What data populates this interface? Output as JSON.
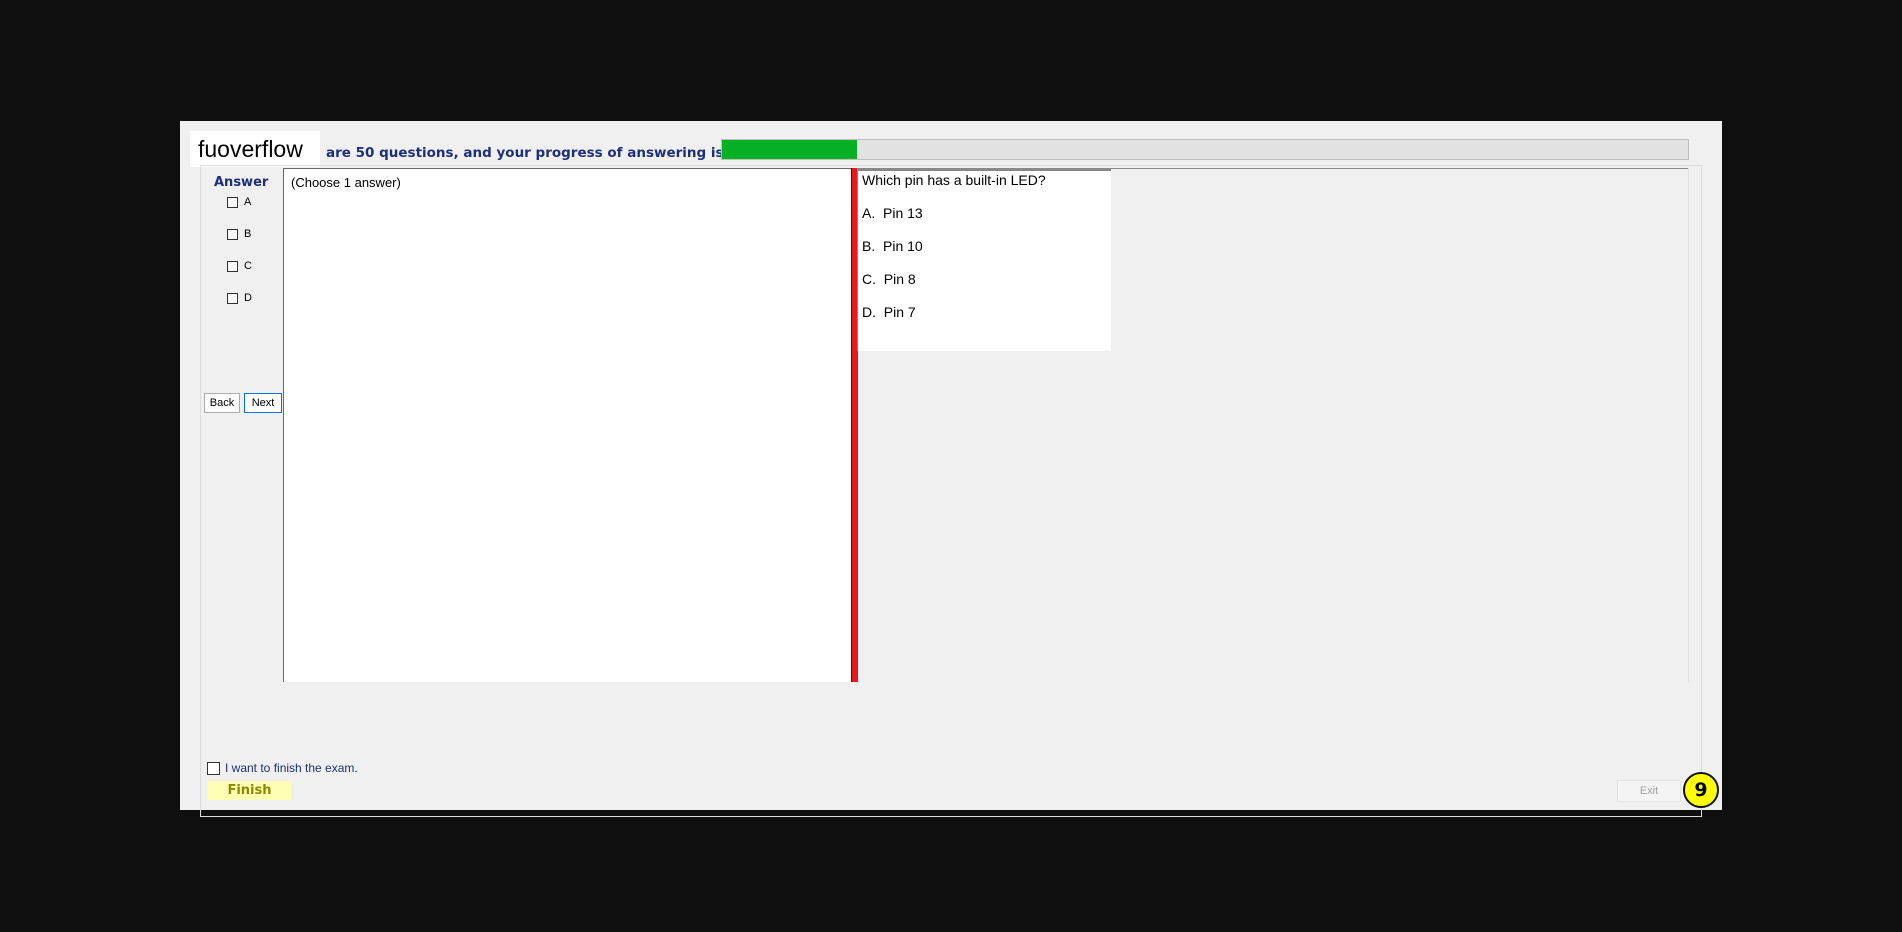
{
  "header": {
    "logo_text": "fuoverflow",
    "progress_text": "are 50 questions, and your progress of answering is",
    "progress_fraction": 0.14
  },
  "answer_section": {
    "title": "Answer",
    "options": [
      "A",
      "B",
      "C",
      "D"
    ],
    "back_label": "Back",
    "next_label": "Next",
    "hint": "(Choose 1 answer)"
  },
  "question": {
    "text": "Which pin has a built-in LED?",
    "choices": [
      "A.  Pin 13",
      "B.  Pin 10",
      "C.  Pin 8",
      "D.  Pin 7"
    ]
  },
  "footer": {
    "finish_check_label": "I want to finish the exam.",
    "finish_label": "Finish",
    "exit_label": "Exit",
    "badge_number": "9"
  },
  "colors": {
    "progress": "#06b025",
    "splitter": "#e6191c",
    "finish_bg": "#ffffb3",
    "badge": "#ffff00"
  }
}
